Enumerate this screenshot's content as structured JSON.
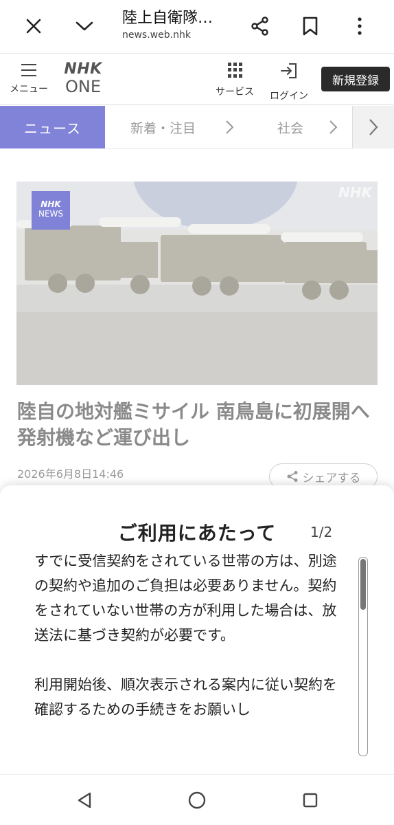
{
  "browser": {
    "title": "陸上自衛隊…",
    "url": "news.web.nhk"
  },
  "header": {
    "menu_label": "メニュー",
    "logo_top": "NHK",
    "logo_bottom": "ONE",
    "services_label": "サービス",
    "login_label": "ログイン",
    "signup_label": "新規登録"
  },
  "category_nav": {
    "active": "ニュース",
    "items": [
      "新着・注目",
      "社会"
    ]
  },
  "article": {
    "image_badge_top": "NHK",
    "image_badge_bottom": "NEWS",
    "image_watermark": "NHK",
    "title": "陸自の地対艦ミサイル 南鳥島に初展開へ 発射機など運び出し",
    "date": "2026年6月8日14:46",
    "share_label": "シェアする"
  },
  "modal": {
    "title": "ご利用にあたって",
    "page_indicator": "1/2",
    "paragraphs": [
      "すでに受信契約をされている世帯の方は、別途の契約や追加のご負担は必要ありません。契約をされていない世帯の方が利用した場合は、放送法に基づき契約が必要です。",
      "利用開始後、順次表示される案内に従い契約を確認するための手続きをお願いし"
    ],
    "scroll_position": 0.0
  },
  "colors": {
    "accent": "#8183d9",
    "signup_bg": "#2a2a2a"
  }
}
